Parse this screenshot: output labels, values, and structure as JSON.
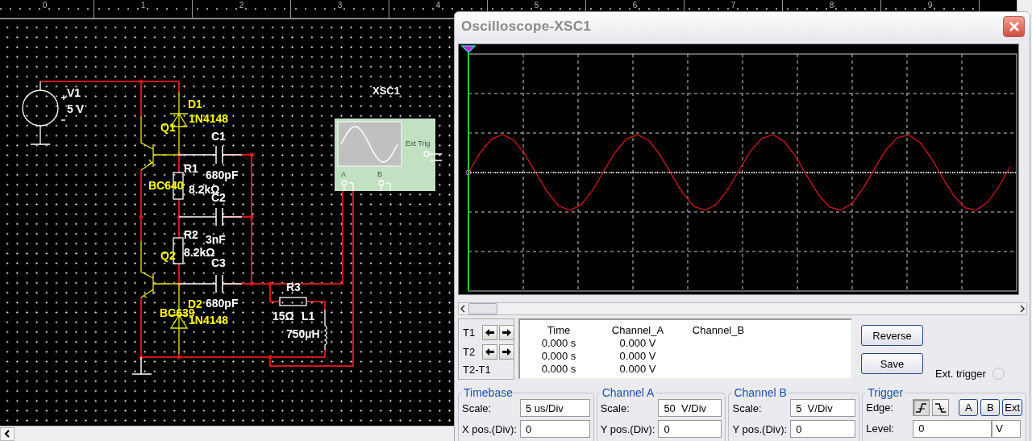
{
  "ruler": [
    "0",
    "1",
    "2",
    "3",
    "4",
    "5",
    "6",
    "7",
    "8",
    "9"
  ],
  "schematic": {
    "labels": [
      {
        "text": "V1",
        "color": "#ffffff"
      },
      {
        "text": "5 V",
        "color": "#ffffff"
      },
      {
        "text": "D1",
        "color": "#ffff00"
      },
      {
        "text": "1N4148",
        "color": "#ffff00"
      },
      {
        "text": "Q1",
        "color": "#ffff00"
      },
      {
        "text": "C1",
        "color": "#ffffff"
      },
      {
        "text": "R1",
        "color": "#ffffff"
      },
      {
        "text": "680pF",
        "color": "#ffffff"
      },
      {
        "text": "BC640",
        "color": "#ffff00"
      },
      {
        "text": "8.2kΩ",
        "color": "#ffffff"
      },
      {
        "text": "C2",
        "color": "#ffffff"
      },
      {
        "text": "R2",
        "color": "#ffffff"
      },
      {
        "text": "3nF",
        "color": "#ffffff"
      },
      {
        "text": "8.2kΩ",
        "color": "#ffffff"
      },
      {
        "text": "Q2",
        "color": "#ffff00"
      },
      {
        "text": "C3",
        "color": "#ffffff"
      },
      {
        "text": "D2",
        "color": "#ffff00"
      },
      {
        "text": "680pF",
        "color": "#ffffff"
      },
      {
        "text": "BC639",
        "color": "#ffff00"
      },
      {
        "text": "1N4148",
        "color": "#ffff00"
      },
      {
        "text": "R3",
        "color": "#ffffff"
      },
      {
        "text": "15Ω",
        "color": "#ffffff"
      },
      {
        "text": "L1",
        "color": "#ffffff"
      },
      {
        "text": "750µH",
        "color": "#ffffff"
      }
    ],
    "instrument": {
      "name": "XSC1",
      "ext_label": "Ext Trig",
      "ports": [
        "A",
        "B"
      ]
    }
  },
  "scope": {
    "title": "Oscilloscope-XSC1",
    "cursors": [
      {
        "label": "T1"
      },
      {
        "label": "T2"
      }
    ],
    "diff_label": "T2-T1",
    "readout": {
      "columns": [
        "Time",
        "Channel_A",
        "Channel_B"
      ],
      "rows": [
        {
          "time": "0.000 s",
          "channel_a": "0.000 V"
        },
        {
          "time": "0.000 s",
          "channel_a": "0.000 V"
        },
        {
          "time": "0.000 s",
          "channel_a": "0.000 V"
        }
      ]
    },
    "buttons": [
      "Reverse",
      "Save"
    ],
    "ext_trigger": {
      "label": "Ext. trigger",
      "on": false
    },
    "groups": [
      {
        "title": "Timebase",
        "fields": [
          {
            "label": "Scale:",
            "value": "5 us/Div"
          },
          {
            "label": "X pos.(Div):",
            "value": "0"
          }
        ]
      },
      {
        "title": "Channel A",
        "fields": [
          {
            "label": "Scale:",
            "value": "50  V/Div"
          },
          {
            "label": "Y pos.(Div):",
            "value": "0"
          }
        ]
      },
      {
        "title": "Channel B",
        "fields": [
          {
            "label": "Scale:",
            "value": "5  V/Div"
          },
          {
            "label": "Y pos.(Div):",
            "value": "0"
          }
        ]
      }
    ],
    "trigger": {
      "title": "Trigger",
      "edge_label": "Edge:",
      "edges": [
        {
          "kind": "rising",
          "selected": true
        },
        {
          "kind": "falling",
          "selected": false
        }
      ],
      "sources": [
        {
          "label": "A",
          "selected": false
        },
        {
          "label": "B",
          "selected": false
        },
        {
          "label": "Ext",
          "selected": false
        }
      ],
      "level_label": "Level:",
      "level_value": "0",
      "level_unit": "V"
    }
  }
}
